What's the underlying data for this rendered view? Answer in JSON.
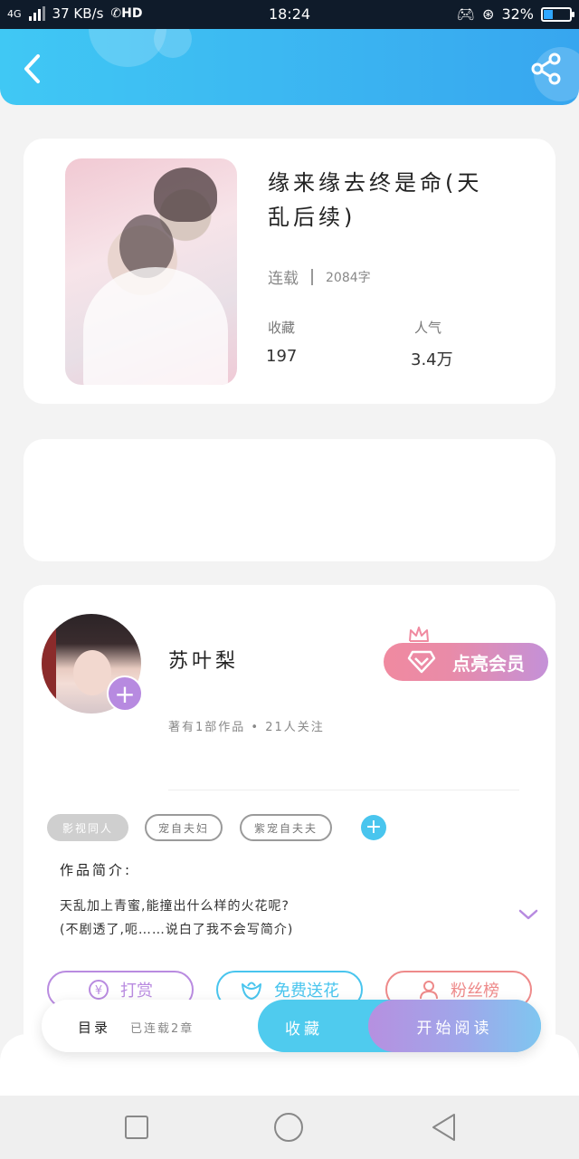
{
  "statusbar": {
    "network": "4G",
    "speed": "37 KB/s",
    "hd": "HD",
    "time": "18:24",
    "battery": "32%",
    "battery_level": 0.32
  },
  "header": {
    "back_icon": "chevron-left-icon",
    "share_icon": "share-icon"
  },
  "book": {
    "title": "缘来缘去终是命(天乱后续)",
    "status": "连载",
    "word_count": "2084字",
    "favorites_label": "收藏",
    "favorites_value": "197",
    "popularity_label": "人气",
    "popularity_value": "3.4万"
  },
  "author": {
    "name": "苏叶梨",
    "meta": "著有1部作品 • 21人关注",
    "vip_label": "点亮会员",
    "tags": [
      "影视同人",
      "宠自夫妇",
      "紫宠自夫夫"
    ],
    "intro_title": "作品简介:",
    "intro_lines": [
      "天乱加上青蜜,能撞出什么样的火花呢?",
      "(不剧透了,呃……说白了我不会写简介)"
    ]
  },
  "actions": {
    "reward": "打赏",
    "flower": "免费送花",
    "fans": "粉丝榜"
  },
  "bottom_bar": {
    "toc": "目录",
    "serial": "已连载2章",
    "collect": "收藏",
    "read": "开始阅读"
  },
  "colors": {
    "accent_blue": "#4fcbee",
    "accent_purple": "#b78ae0",
    "vip_pink": "#f08aa0",
    "reward_purple": "#b98be0",
    "flower_blue": "#49c5ee",
    "fans_pink": "#ee8a8a"
  }
}
